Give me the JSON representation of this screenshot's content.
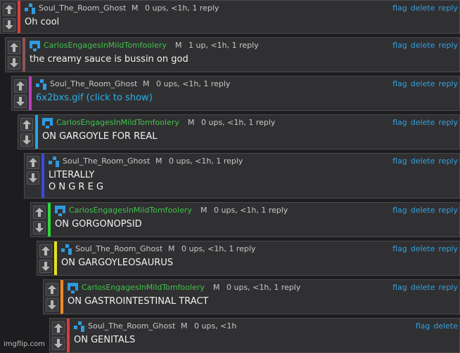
{
  "actions": {
    "flag": "flag",
    "delete": "delete",
    "reply": "reply"
  },
  "mod_badge": "M",
  "comments": [
    {
      "user": "Soul_The_Room_Ghost",
      "stats": "0 ups, <1h, 1 reply",
      "text": "Oh cool",
      "bar_color": "#e03a3a"
    },
    {
      "user": "CarlosEngagesInMildTomfoolery",
      "stats": "1 up, <1h, 1 reply",
      "text": "the creamy sauce is bussin on god",
      "bar_color": "#8a5656"
    },
    {
      "user": "Soul_The_Room_Ghost",
      "stats": "0 ups, <1h, 1 reply",
      "text": "6x2bxs.gif (click to show)",
      "bar_color": "#c238c2"
    },
    {
      "user": "CarlosEngagesInMildTomfoolery",
      "stats": "0 ups, <1h, 1 reply",
      "text": "ON GARGOYLE FOR REAL",
      "bar_color": "#23a6e8"
    },
    {
      "user": "Soul_The_Room_Ghost",
      "stats": "0 ups, <1h, 1 reply",
      "text": "LITERALLY",
      "text2": "O N G R E G",
      "bar_color": "#3a48e8"
    },
    {
      "user": "CarlosEngagesInMildTomfoolery",
      "stats": "0 ups, <1h, 1 reply",
      "text": "ON GORGONOPSID",
      "bar_color": "#2fd63a"
    },
    {
      "user": "Soul_The_Room_Ghost",
      "stats": "0 ups, <1h, 1 reply",
      "text": "ON GARGOYLEOSAURUS",
      "bar_color": "#e6e020"
    },
    {
      "user": "CarlosEngagesInMildTomfoolery",
      "stats": "0 ups, <1h, 1 reply",
      "text": "ON GASTROINTESTINAL TRACT",
      "bar_color": "#f08a20"
    },
    {
      "user": "Soul_The_Room_Ghost",
      "stats": "0 ups, <1h",
      "text": "ON GENITALS",
      "bar_color": "#e03a3a"
    }
  ],
  "watermark": "imgflip.com"
}
